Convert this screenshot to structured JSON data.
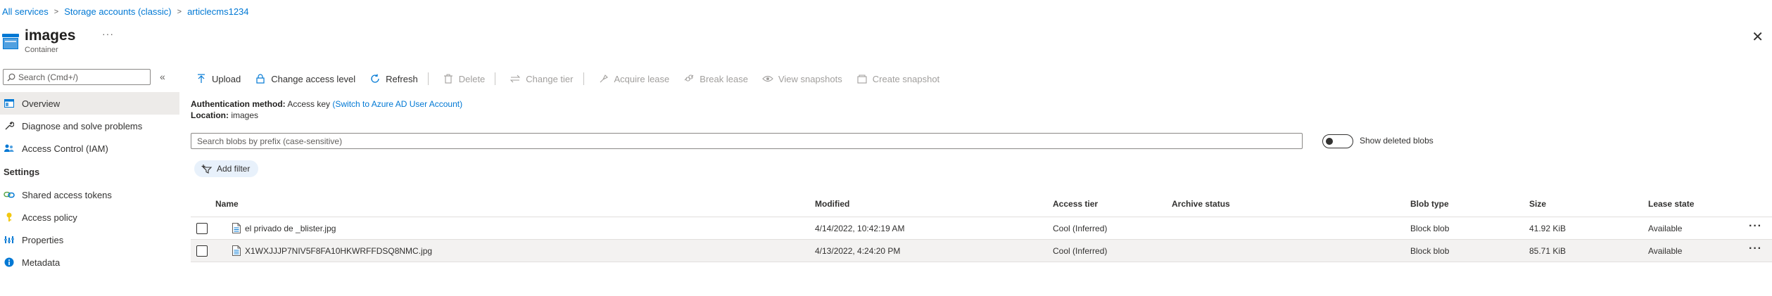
{
  "breadcrumb": [
    "All services",
    "Storage accounts (classic)",
    "articlecms1234"
  ],
  "page": {
    "title": "images",
    "subtitle": "Container",
    "more": "···"
  },
  "sidebar": {
    "search_placeholder": "Search (Cmd+/)",
    "collapse": "«",
    "items": [
      {
        "label": "Overview",
        "icon": "overview-icon"
      },
      {
        "label": "Diagnose and solve problems",
        "icon": "wrench-icon"
      },
      {
        "label": "Access Control (IAM)",
        "icon": "people-icon"
      }
    ],
    "section": "Settings",
    "settings_items": [
      {
        "label": "Shared access tokens",
        "icon": "link-icon"
      },
      {
        "label": "Access policy",
        "icon": "key-icon"
      },
      {
        "label": "Properties",
        "icon": "bars-icon"
      },
      {
        "label": "Metadata",
        "icon": "info-icon"
      }
    ]
  },
  "toolbar": {
    "upload": "Upload",
    "change_access": "Change access level",
    "refresh": "Refresh",
    "delete": "Delete",
    "change_tier": "Change tier",
    "acquire_lease": "Acquire lease",
    "break_lease": "Break lease",
    "view_snapshots": "View snapshots",
    "create_snapshot": "Create snapshot"
  },
  "auth": {
    "method_label": "Authentication method:",
    "method_value": "Access key",
    "switch_link": "(Switch to Azure AD User Account)",
    "location_label": "Location:",
    "location_value": "images"
  },
  "blob_search_placeholder": "Search blobs by prefix (case-sensitive)",
  "show_deleted_label": "Show deleted blobs",
  "add_filter": "Add filter",
  "table": {
    "columns": [
      "Name",
      "Modified",
      "Access tier",
      "Archive status",
      "Blob type",
      "Size",
      "Lease state"
    ],
    "rows": [
      {
        "name": "el privado de _blister.jpg",
        "modified": "4/14/2022, 10:42:19 AM",
        "tier": "Cool (Inferred)",
        "archive": "",
        "type": "Block blob",
        "size": "41.92 KiB",
        "lease": "Available"
      },
      {
        "name": "X1WXJJJP7NIV5F8FA10HKWRFFDSQ8NMC.jpg",
        "modified": "4/13/2022, 4:24:20 PM",
        "tier": "Cool (Inferred)",
        "archive": "",
        "type": "Block blob",
        "size": "85.71 KiB",
        "lease": "Available"
      }
    ]
  },
  "colors": {
    "accent": "#0078d4",
    "selected_nav": "#edebe9",
    "filter_pill": "#e8f1fb"
  }
}
